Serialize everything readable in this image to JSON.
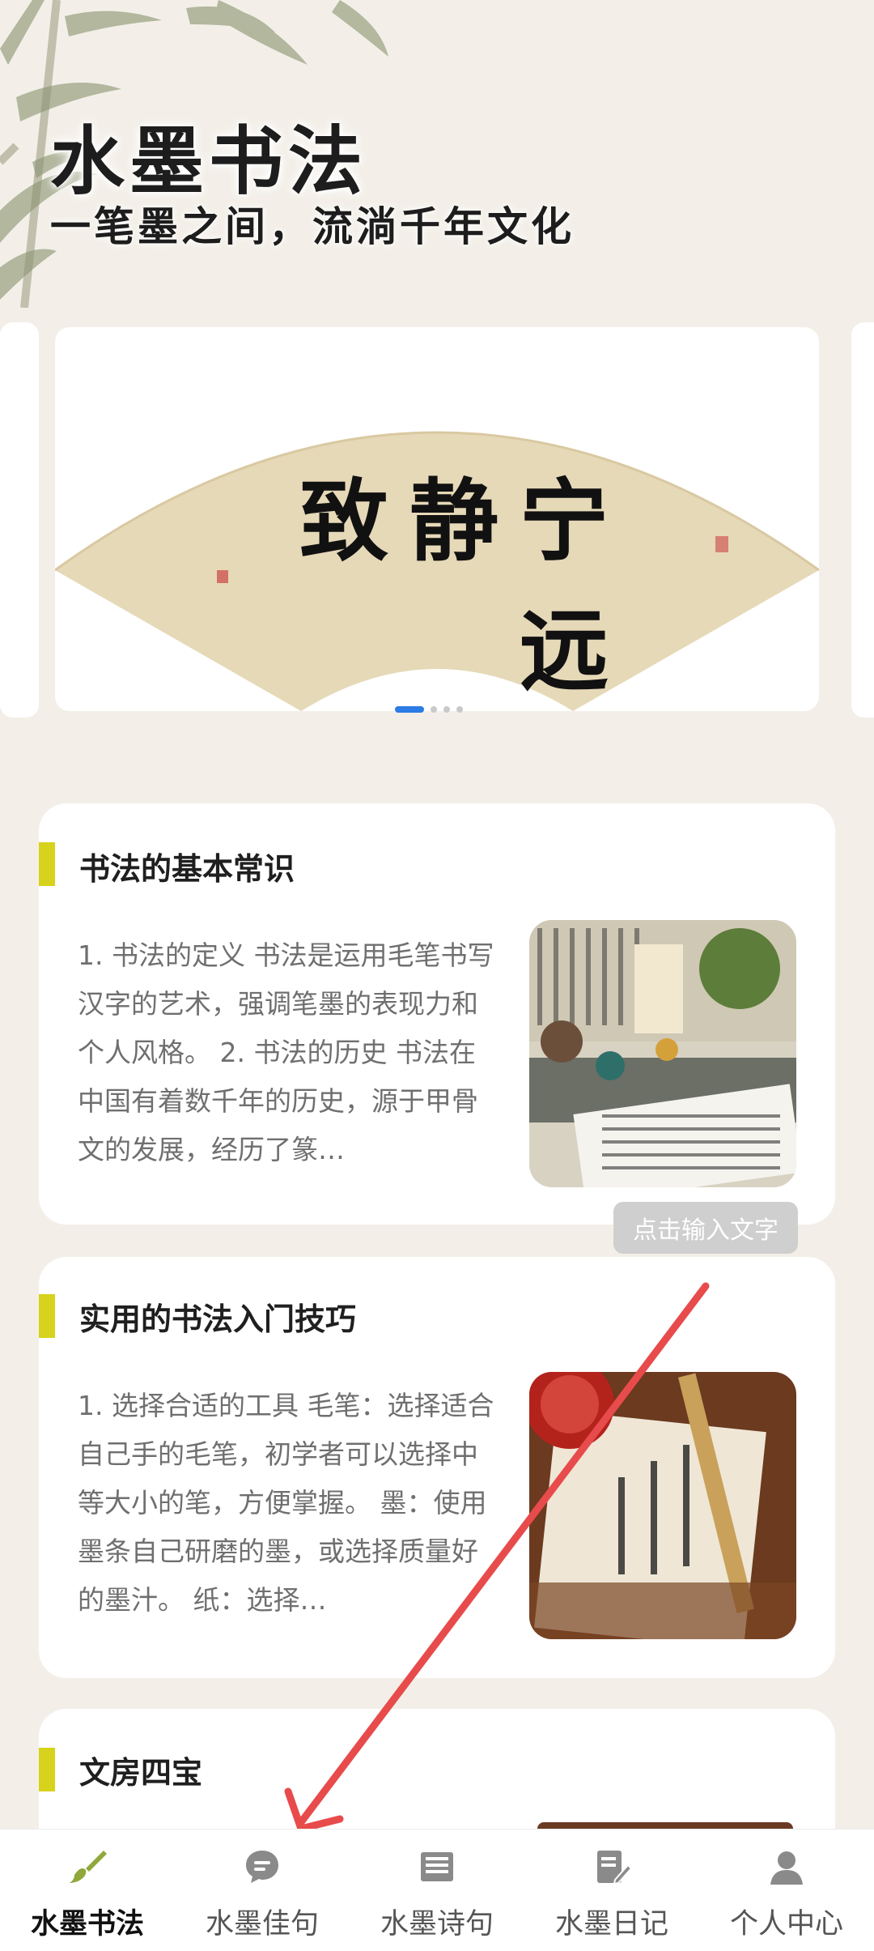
{
  "header": {
    "title": "水墨书法",
    "subtitle": "一笔墨之间，流淌千年文化"
  },
  "banner": {
    "fan_text": "宁静致远",
    "active_index": 0,
    "total_slides": 4
  },
  "cards": [
    {
      "title": "书法的基本常识",
      "text": "1. 书法的定义 书法是运用毛笔书写汉字的艺术，强调笔墨的表现力和个人风格。 2. 书法的历史 书法在中国有着数千年的历史，源于甲骨文的发展，经历了篆…"
    },
    {
      "title": "实用的书法入门技巧",
      "text": "1. 选择合适的工具 毛笔：选择适合自己手的毛笔，初学者可以选择中等大小的笔，方便掌握。 墨：使用墨条自己研磨的墨，或选择质量好的墨汁。 纸：选择…"
    },
    {
      "title": "文房四宝"
    }
  ],
  "tooltip": "点击输入文字",
  "tabs": [
    {
      "label": "水墨书法",
      "icon": "brush-icon",
      "active": true
    },
    {
      "label": "水墨佳句",
      "icon": "chat-bubble-icon",
      "active": false
    },
    {
      "label": "水墨诗句",
      "icon": "newspaper-icon",
      "active": false
    },
    {
      "label": "水墨日记",
      "icon": "note-edit-icon",
      "active": false
    },
    {
      "label": "个人中心",
      "icon": "user-icon",
      "active": false
    }
  ],
  "colors": {
    "background": "#f3efe8",
    "accent_bar": "#d7d21b",
    "active_dot": "#2d7be5",
    "arrow": "#e84b4b",
    "brush_green": "#8fa83a"
  }
}
